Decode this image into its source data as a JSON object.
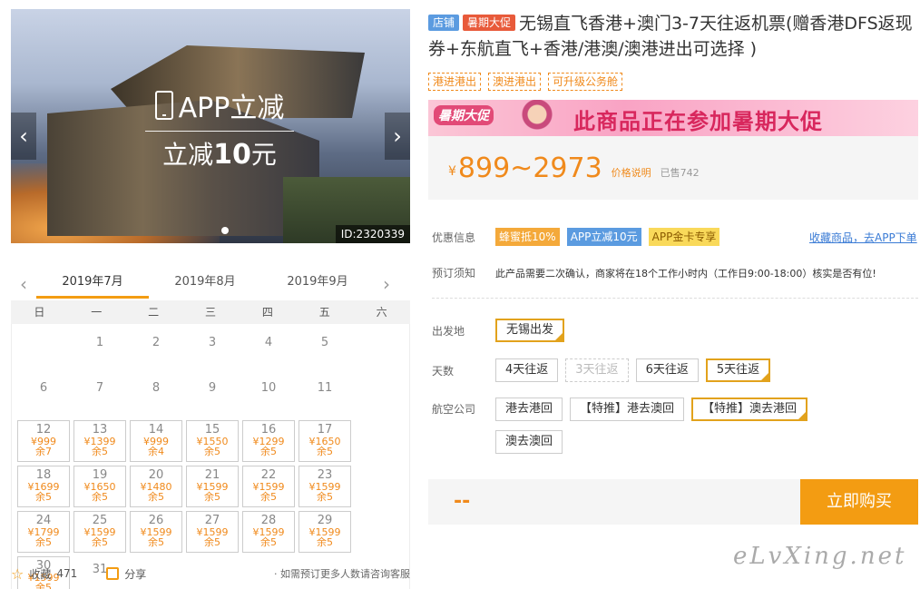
{
  "hero": {
    "promo_line1": "APP立减",
    "promo_line2_prefix": "立减",
    "promo_line2_amount": "10",
    "promo_line2_suffix": "元",
    "prev_icon": "‹",
    "next_icon": "›",
    "image_id": "ID:2320339"
  },
  "calendar": {
    "months": [
      "2019年7月",
      "2019年8月",
      "2019年9月"
    ],
    "active_month": 0,
    "weekdays": [
      "日",
      "一",
      "二",
      "三",
      "四",
      "五",
      "六"
    ],
    "cells": [
      {
        "day": ""
      },
      {
        "day": "1"
      },
      {
        "day": "2"
      },
      {
        "day": "3"
      },
      {
        "day": "4"
      },
      {
        "day": "5"
      },
      {
        "day": "6"
      },
      {
        "day": "7"
      },
      {
        "day": "8"
      },
      {
        "day": "9"
      },
      {
        "day": "10"
      },
      {
        "day": "11"
      },
      {
        "day": "12",
        "price": "¥999",
        "stock": "余7"
      },
      {
        "day": "13",
        "price": "¥1399",
        "stock": "余5"
      },
      {
        "day": "14",
        "price": "¥999",
        "stock": "余4"
      },
      {
        "day": "15",
        "price": "¥1550",
        "stock": "余5"
      },
      {
        "day": "16",
        "price": "¥1299",
        "stock": "余5"
      },
      {
        "day": "17",
        "price": "¥1650",
        "stock": "余5"
      },
      {
        "day": "18",
        "price": "¥1699",
        "stock": "余5"
      },
      {
        "day": "19",
        "price": "¥1650",
        "stock": "余5"
      },
      {
        "day": "20",
        "price": "¥1480",
        "stock": "余5"
      },
      {
        "day": "21",
        "price": "¥1599",
        "stock": "余5"
      },
      {
        "day": "22",
        "price": "¥1599",
        "stock": "余5"
      },
      {
        "day": "23",
        "price": "¥1599",
        "stock": "余5"
      },
      {
        "day": "24",
        "price": "¥1799",
        "stock": "余5"
      },
      {
        "day": "25",
        "price": "¥1599",
        "stock": "余5"
      },
      {
        "day": "26",
        "price": "¥1599",
        "stock": "余5"
      },
      {
        "day": "27",
        "price": "¥1599",
        "stock": "余5"
      },
      {
        "day": "28",
        "price": "¥1599",
        "stock": "余5"
      },
      {
        "day": "29",
        "price": "¥1599",
        "stock": "余5"
      },
      {
        "day": "30",
        "price": "¥1599",
        "stock": "余5"
      },
      {
        "day": "31"
      }
    ]
  },
  "actions": {
    "favorite_label": "收藏",
    "favorite_count": "471",
    "share_label": "分享",
    "note": "· 如需预订更多人数请咨询客服"
  },
  "product": {
    "tag_store": "店铺",
    "tag_promo": "暑期大促",
    "title": "无锡直飞香港+澳门3-7天往返机票(赠香港DFS返现券+东航直飞+香港/港澳/澳港进出可选择 )",
    "chips": [
      "港进港出",
      "澳进港出",
      "可升级公务舱"
    ]
  },
  "banner": {
    "label": "暑期大促",
    "text": "此商品正在参加暑期大促"
  },
  "price": {
    "currency": "¥",
    "range": "899~2973",
    "explain_link": "价格说明",
    "sold": "已售742"
  },
  "offers": {
    "label": "优惠信息",
    "badges": [
      "蜂蜜抵10%",
      "APP立减10元",
      "APP金卡专享"
    ],
    "fav_link": "收藏商品，去APP下单"
  },
  "booking": {
    "label": "预订须知",
    "text": "此产品需要二次确认，商家将在18个工作小时内（工作日9:00-18:00）核实是否有位!"
  },
  "options": {
    "departure_label": "出发地",
    "departure": "无锡出发",
    "days_label": "天数",
    "days": [
      "4天往返",
      "3天往返",
      "6天往返",
      "5天往返"
    ],
    "airline_label": "航空公司",
    "airlines": [
      "港去港回",
      "【特推】港去澳回",
      "【特推】澳去港回",
      "澳去澳回"
    ]
  },
  "buy": {
    "price_placeholder": "--",
    "button": "立即购买"
  },
  "watermark": "eLvXing.net",
  "colors": {
    "accent": "#f39c12",
    "price": "#f08a1c",
    "link": "#3a7bd5"
  }
}
